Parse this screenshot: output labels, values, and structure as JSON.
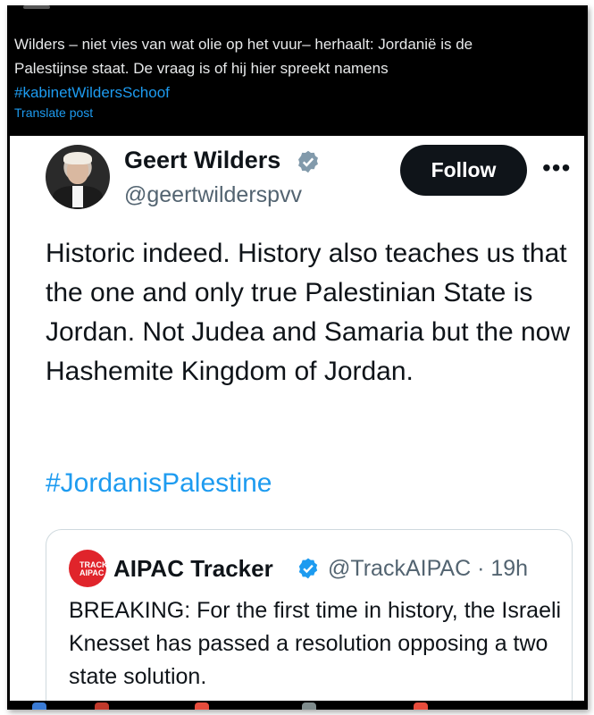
{
  "post": {
    "text_line1": "Wilders – niet vies van wat olie op het vuur– herhaalt: Jordanië is de",
    "text_line2": "Palestijnse staat. De vraag is of hij hier spreekt namens",
    "hashtag": "#kabinetWildersSchoof",
    "translate_label": "Translate post"
  },
  "embedded_post": {
    "author_name": "Geert Wilders",
    "author_handle": "@geertwilderspvv",
    "follow_label": "Follow",
    "more_label": "•••",
    "body": "Historic indeed. History also teaches us that the one and only true Palestinian State is Jordan. Not Judea and Samaria but the now Hashemite Kingdom of Jordan.",
    "hashtag": "#JordanisPalestine",
    "quoted": {
      "author_name": "AIPAC Tracker",
      "author_handle": "@TrackAIPAC · 19h",
      "logo_text": "TRACK AIPAC",
      "body": "BREAKING: For the first time in history, the Israeli Knesset has passed a resolution opposing a two state solution."
    }
  },
  "colors": {
    "background_dark": "#000000",
    "text_light": "#e7e9ea",
    "link_blue": "#1d9bf0",
    "verified_blue": "#1d9bf0",
    "follow_button": "#0f1419",
    "aipac_red": "#e0242b"
  },
  "icons": {
    "verified": "verified-badge-icon",
    "more": "more-options-icon",
    "logo": "aipac-tracker-logo-icon"
  }
}
